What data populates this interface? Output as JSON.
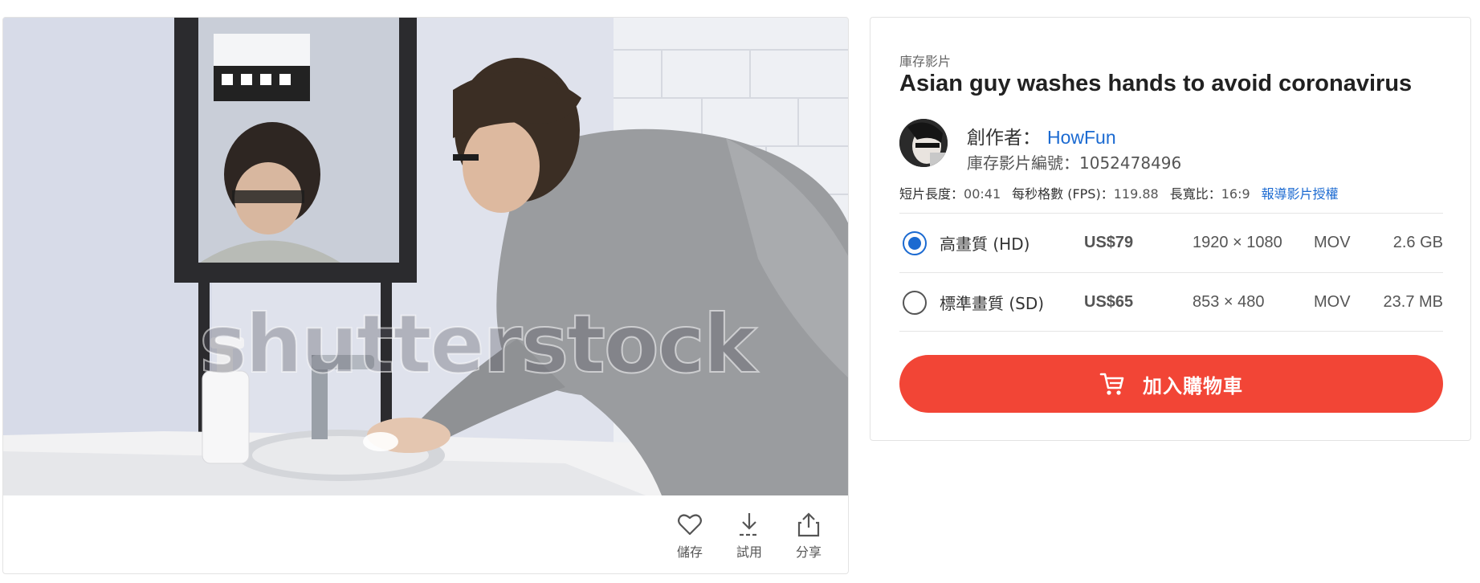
{
  "media": {
    "watermark": "shutterstock",
    "actions": [
      {
        "icon": "heart-icon",
        "label": "儲存"
      },
      {
        "icon": "download-icon",
        "label": "試用"
      },
      {
        "icon": "share-icon",
        "label": "分享"
      }
    ]
  },
  "details": {
    "kind": "庫存影片",
    "title": "Asian guy washes hands to avoid coronavirus",
    "creator": {
      "label": "創作者：",
      "name": "HowFun"
    },
    "stock_id": "庫存影片編號：1052478496",
    "meta": {
      "duration_label": "短片長度：",
      "duration": "00:41",
      "fps_label": "每秒格數 (FPS)：",
      "fps": "119.88",
      "ratio_label": "長寬比：",
      "ratio": "16:9",
      "license_link": "報導影片授權"
    },
    "options": [
      {
        "name": "高畫質 (HD)",
        "price": "US$79",
        "resolution": "1920 × 1080",
        "format": "MOV",
        "size": "2.6 GB",
        "selected": true
      },
      {
        "name": "標準畫質 (SD)",
        "price": "US$65",
        "resolution": "853 × 480",
        "format": "MOV",
        "size": "23.7 MB",
        "selected": false
      }
    ],
    "cart_button": "加入購物車"
  },
  "colors": {
    "accent": "#1b6ad1",
    "cart": "#f24536"
  }
}
